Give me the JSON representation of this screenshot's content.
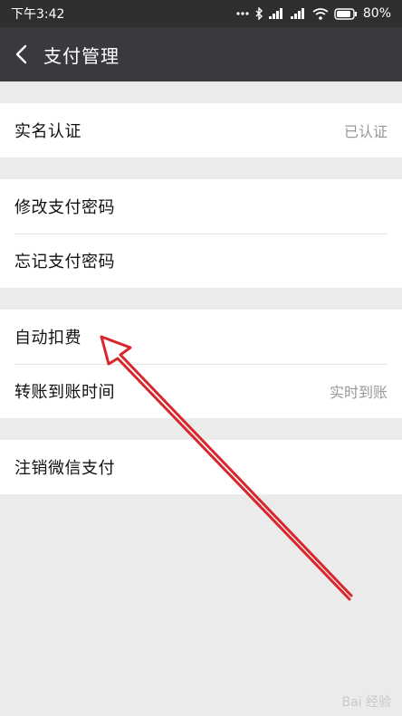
{
  "status_bar": {
    "time": "下午3:42",
    "battery": "80%"
  },
  "nav": {
    "title": "支付管理",
    "back_icon": "chevron-left-icon"
  },
  "groups": [
    {
      "items": [
        {
          "label": "实名认证",
          "value": "已认证"
        }
      ]
    },
    {
      "items": [
        {
          "label": "修改支付密码"
        },
        {
          "label": "忘记支付密码"
        }
      ]
    },
    {
      "items": [
        {
          "label": "自动扣费"
        },
        {
          "label": "转账到账时间",
          "value": "实时到账"
        }
      ]
    },
    {
      "items": [
        {
          "label": "注销微信支付"
        }
      ]
    }
  ],
  "annotation": {
    "color": "#d8262c",
    "type": "arrow"
  },
  "watermark": {
    "text": "Bai 经验"
  }
}
